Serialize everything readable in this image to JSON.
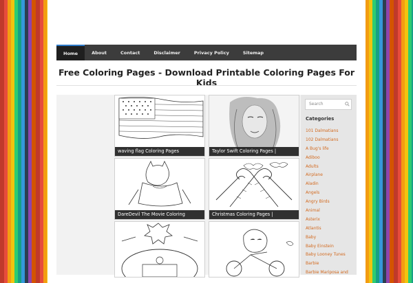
{
  "nav": {
    "items": [
      {
        "label": "Home"
      },
      {
        "label": "About"
      },
      {
        "label": "Contact"
      },
      {
        "label": "Disclaimer"
      },
      {
        "label": "Privacy Policy"
      },
      {
        "label": "Sitemap"
      }
    ]
  },
  "site_title": "Free Coloring Pages - Download Printable Coloring Pages For Kids",
  "cards": [
    {
      "caption": "waving flag Coloring Pages"
    },
    {
      "caption": "Taylor Swift Coloring Pages |"
    },
    {
      "caption": "DareDevil The Movie Coloring"
    },
    {
      "caption": "Christmas Coloring Pages |"
    },
    {
      "caption": ""
    },
    {
      "caption": ""
    }
  ],
  "sidebar": {
    "search_placeholder": "Search",
    "categories_heading": "Categories",
    "categories": [
      "101 Dalmatians",
      "102 Dalmatians",
      "A Bug's life",
      "Adiboo",
      "Adults",
      "Airplane",
      "Aladin",
      "Angels",
      "Angry Birds",
      "Animal",
      "Asterix",
      "Atlantis",
      "Baby",
      "Baby Einstein",
      "Baby Looney Tunes",
      "Barbie",
      "Barbie Mariposa and"
    ]
  },
  "colors": {
    "nav_bg": "#3c3c3c",
    "nav_active_bg": "#1f1f1f",
    "category_link": "#d2691e",
    "caption_bg": "#141414"
  },
  "icons": {
    "search": "search-icon"
  }
}
